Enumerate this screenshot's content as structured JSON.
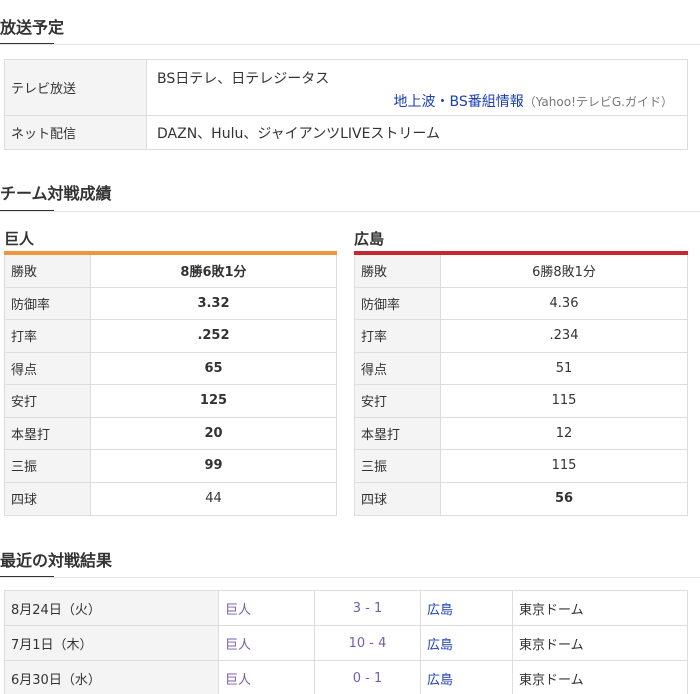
{
  "broadcast": {
    "title": "放送予定",
    "tv_label": "テレビ放送",
    "tv_value": "BS日テレ、日テレジータス",
    "tv_link": "地上波・BS番組情報",
    "tv_link_note": "（Yahoo!テレビG.ガイド）",
    "net_label": "ネット配信",
    "net_value": "DAZN、Hulu、ジャイアンツLIVEストリーム"
  },
  "matchup": {
    "title": "チーム対戦成績",
    "colors": {
      "giants": "#f0963c",
      "carp": "#c8282d"
    },
    "teams": [
      {
        "name": "巨人",
        "stats": [
          {
            "label": "勝敗",
            "value": "8勝6敗1分",
            "bold": true
          },
          {
            "label": "防御率",
            "value": "3.32",
            "bold": true
          },
          {
            "label": "打率",
            "value": ".252",
            "bold": true
          },
          {
            "label": "得点",
            "value": "65",
            "bold": true
          },
          {
            "label": "安打",
            "value": "125",
            "bold": true
          },
          {
            "label": "本塁打",
            "value": "20",
            "bold": true
          },
          {
            "label": "三振",
            "value": "99",
            "bold": true
          },
          {
            "label": "四球",
            "value": "44",
            "bold": false
          }
        ]
      },
      {
        "name": "広島",
        "stats": [
          {
            "label": "勝敗",
            "value": "6勝8敗1分",
            "bold": false
          },
          {
            "label": "防御率",
            "value": "4.36",
            "bold": false
          },
          {
            "label": "打率",
            "value": ".234",
            "bold": false
          },
          {
            "label": "得点",
            "value": "51",
            "bold": false
          },
          {
            "label": "安打",
            "value": "115",
            "bold": false
          },
          {
            "label": "本塁打",
            "value": "12",
            "bold": false
          },
          {
            "label": "三振",
            "value": "115",
            "bold": false
          },
          {
            "label": "四球",
            "value": "56",
            "bold": true
          }
        ]
      }
    ]
  },
  "results": {
    "title": "最近の対戦結果",
    "rows": [
      {
        "date": "8月24日（火）",
        "home": "巨人",
        "score": "3 - 1",
        "away": "広島",
        "stadium": "東京ドーム"
      },
      {
        "date": "7月1日（木）",
        "home": "巨人",
        "score": "10 - 4",
        "away": "広島",
        "stadium": "東京ドーム"
      },
      {
        "date": "6月30日（水）",
        "home": "巨人",
        "score": "0 - 1",
        "away": "広島",
        "stadium": "東京ドーム"
      }
    ]
  }
}
